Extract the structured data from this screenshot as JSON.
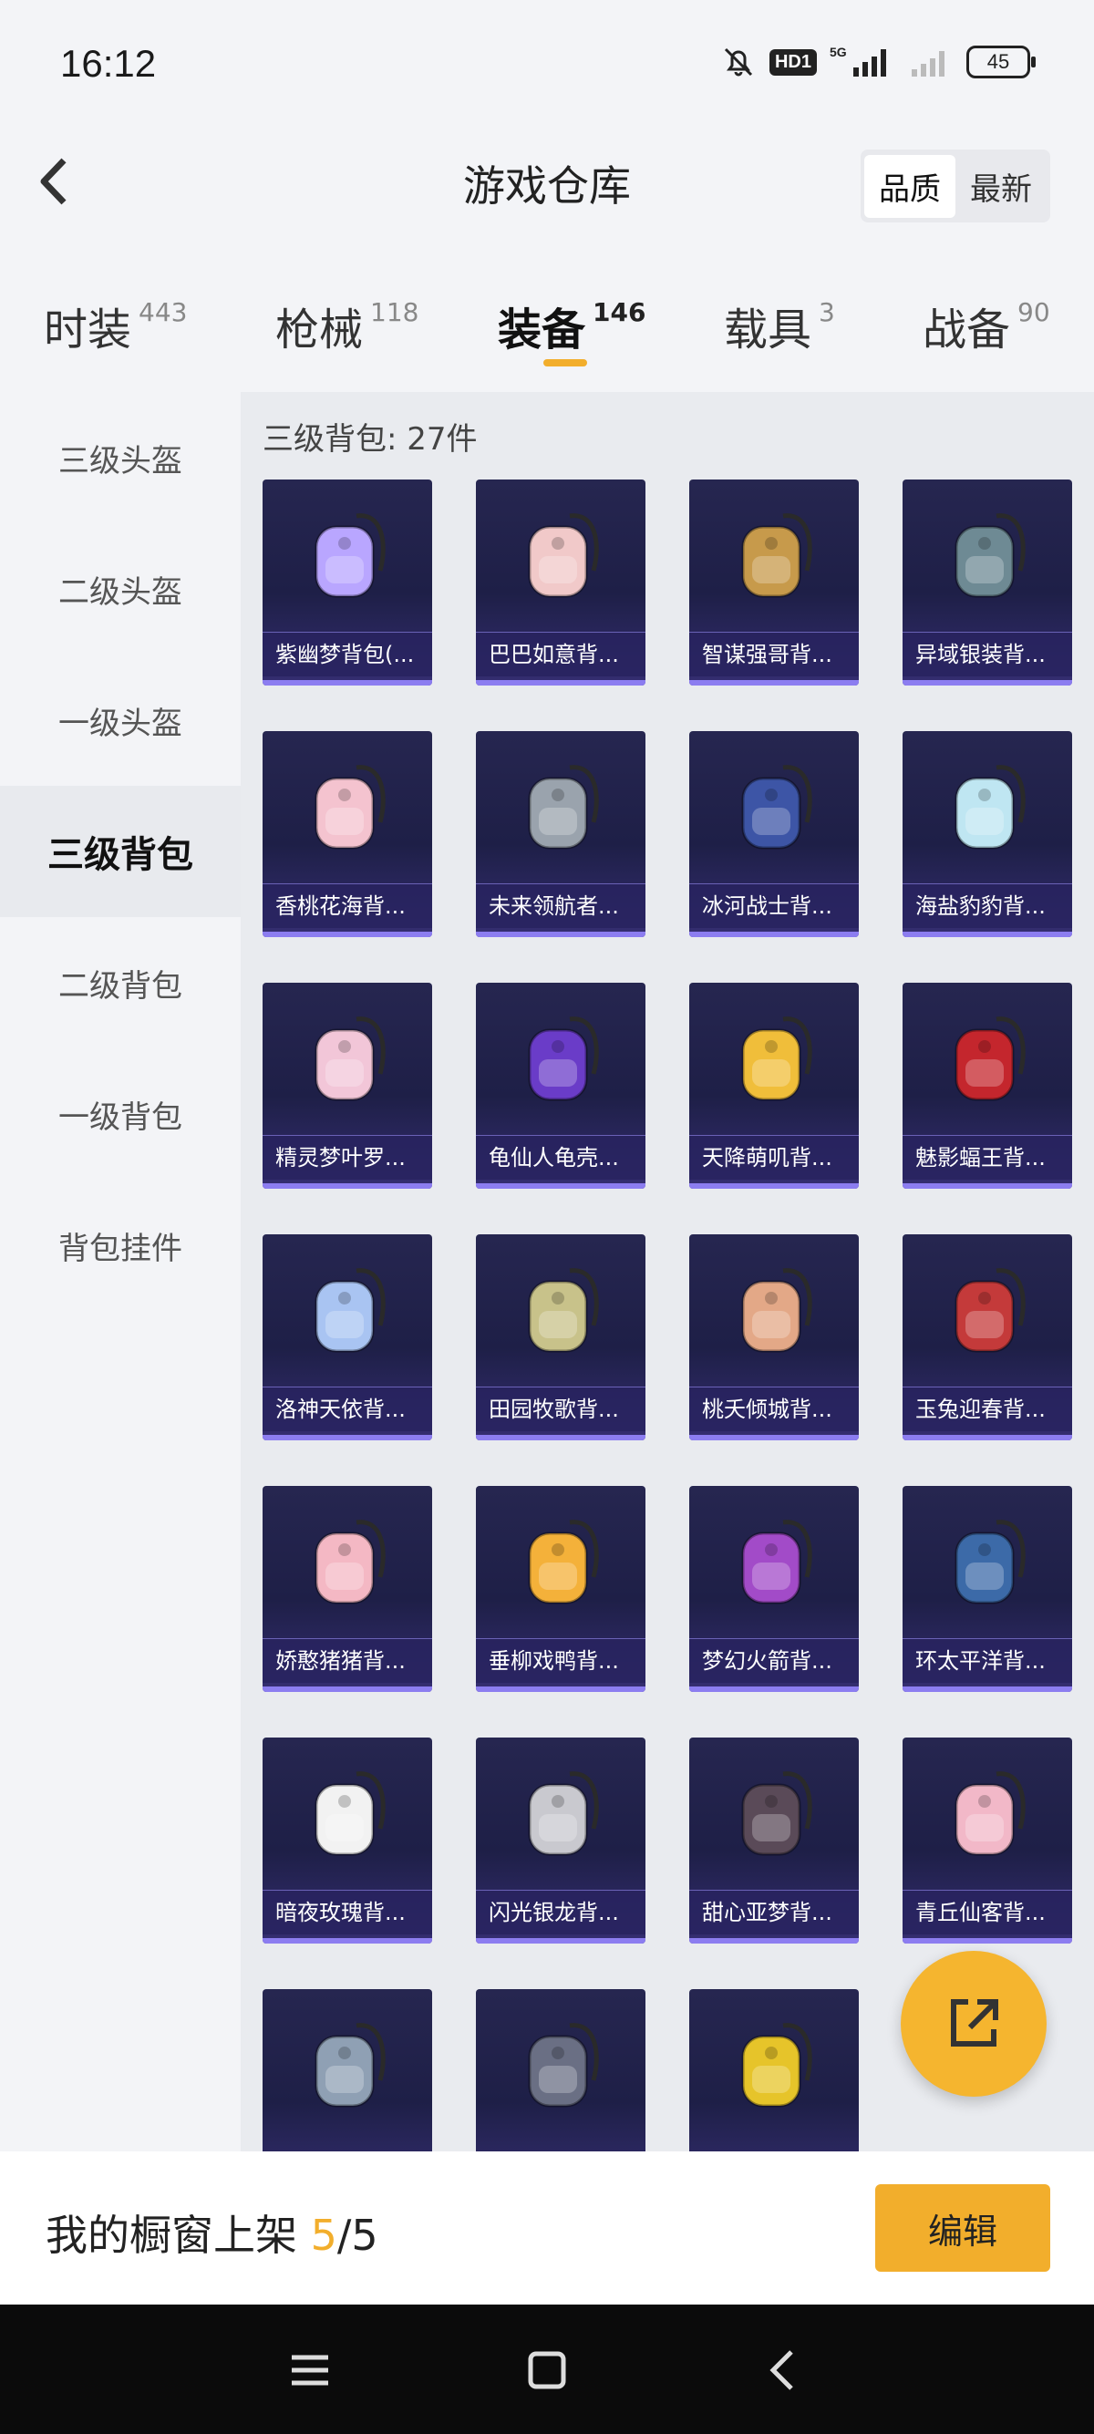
{
  "status": {
    "time": "16:12",
    "hd": "HD1",
    "signal": "5G",
    "battery": "45"
  },
  "header": {
    "title": "游戏仓库",
    "sort_options": [
      "品质",
      "最新"
    ]
  },
  "categories": [
    {
      "label": "时装",
      "count": "443"
    },
    {
      "label": "枪械",
      "count": "118"
    },
    {
      "label": "装备",
      "count": "146"
    },
    {
      "label": "载具",
      "count": "3"
    },
    {
      "label": "战备",
      "count": "90"
    }
  ],
  "sidebar": [
    "三级头盔",
    "二级头盔",
    "一级头盔",
    "三级背包",
    "二级背包",
    "一级背包",
    "背包挂件"
  ],
  "section_title": "三级背包: 27件",
  "items": [
    {
      "name": "紫幽梦背包(...",
      "color": "#b9a6ff"
    },
    {
      "name": "巴巴如意背...",
      "color": "#f1c9c9"
    },
    {
      "name": "智谋强哥背...",
      "color": "#c79a4b"
    },
    {
      "name": "异域银装背...",
      "color": "#6e8a94"
    },
    {
      "name": "香桃花海背...",
      "color": "#f4c3cf"
    },
    {
      "name": "未来领航者...",
      "color": "#9aa3ad"
    },
    {
      "name": "冰河战士背...",
      "color": "#3d55a6"
    },
    {
      "name": "海盐豹豹背...",
      "color": "#bfe6f2"
    },
    {
      "name": "精灵梦叶罗...",
      "color": "#f2c6d8"
    },
    {
      "name": "龟仙人龟壳...",
      "color": "#6a3cc8"
    },
    {
      "name": "天降萌叽背...",
      "color": "#f0be3a"
    },
    {
      "name": "魅影蝠王背...",
      "color": "#c4262d"
    },
    {
      "name": "洛神天依背...",
      "color": "#a9c4f2"
    },
    {
      "name": "田园牧歌背...",
      "color": "#c8c28a"
    },
    {
      "name": "桃夭倾城背...",
      "color": "#e3a887"
    },
    {
      "name": "玉兔迎春背...",
      "color": "#c43a3a"
    },
    {
      "name": "娇憨猪猪背...",
      "color": "#f4b8c4"
    },
    {
      "name": "垂柳戏鸭背...",
      "color": "#f4b13a"
    },
    {
      "name": "梦幻火箭背...",
      "color": "#a24bc8"
    },
    {
      "name": "环太平洋背...",
      "color": "#3c6aa8"
    },
    {
      "name": "暗夜玫瑰背...",
      "color": "#f2f2f2"
    },
    {
      "name": "闪光银龙背...",
      "color": "#c9c9cf"
    },
    {
      "name": "甜心亚梦背...",
      "color": "#5a4a58"
    },
    {
      "name": "青丘仙客背...",
      "color": "#f2b8c8"
    },
    {
      "name": "",
      "color": "#8fa0b4"
    },
    {
      "name": "",
      "color": "#6a6f84"
    },
    {
      "name": "",
      "color": "#e6c42a"
    }
  ],
  "bottom": {
    "shelf_label": "我的橱窗上架",
    "shelf_current": "5",
    "shelf_total": "/5",
    "edit_label": "编辑"
  }
}
